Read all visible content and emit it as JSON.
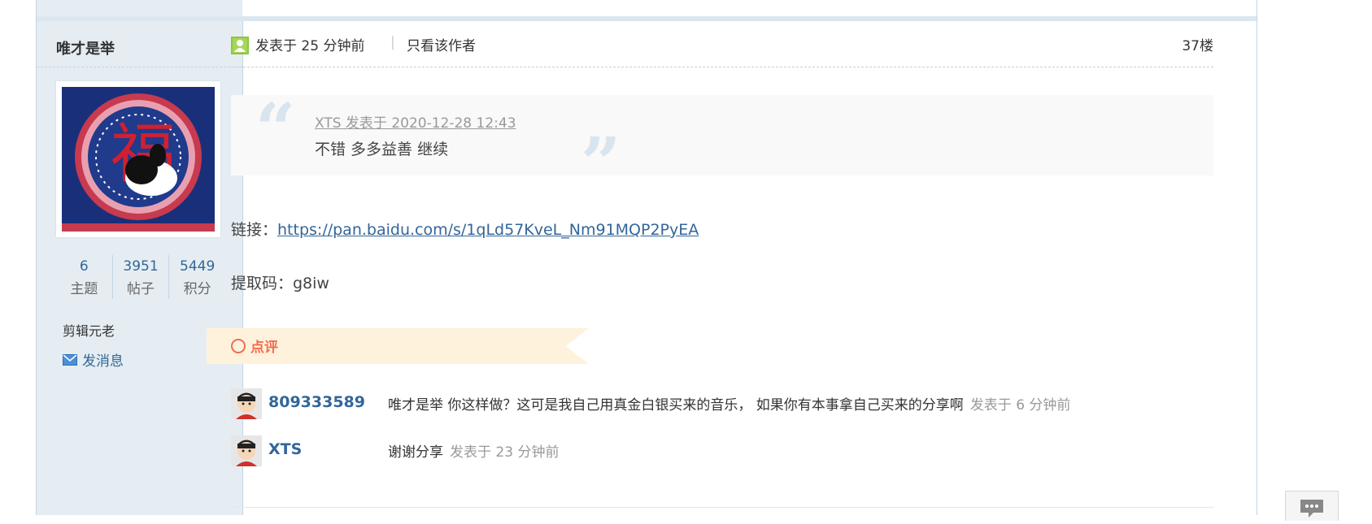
{
  "sidebar": {
    "username": "唯才是举",
    "stats": [
      {
        "value": "6",
        "label": "主题"
      },
      {
        "value": "3951",
        "label": "帖子"
      },
      {
        "value": "5449",
        "label": "积分"
      }
    ],
    "rank": "剪辑元老",
    "pm_label": "发消息"
  },
  "post": {
    "posted": "发表于 25 分钟前",
    "separator": "|",
    "only_author": "只看该作者",
    "floor": "37楼"
  },
  "quote": {
    "author": "XTS 发表于 2020-12-28 12:43",
    "text": "不错  多多益善    继续"
  },
  "content": {
    "link_prefix": "链接：",
    "link_url": "https://pan.baidu.com/s/1qLd57KveL_Nm91MQP2PyEA",
    "code_line": "提取码：g8iw"
  },
  "comments": {
    "title": "点评",
    "items": [
      {
        "user": "809333589",
        "text": "唯才是举 你这样做？这可是我自己用真金白银买来的音乐， 如果你有本事拿自己买来的分享啊",
        "time": "发表于 6 分钟前"
      },
      {
        "user": "XTS",
        "text": "谢谢分享",
        "time": "发表于 23 分钟前"
      }
    ]
  },
  "icons": {
    "online": "user-online-icon",
    "mail": "mail-icon",
    "chat": "chat-bubble-icon"
  },
  "colors": {
    "link": "#336699",
    "accent": "#f26c4f",
    "sidebar_bg": "#e5edf2"
  }
}
